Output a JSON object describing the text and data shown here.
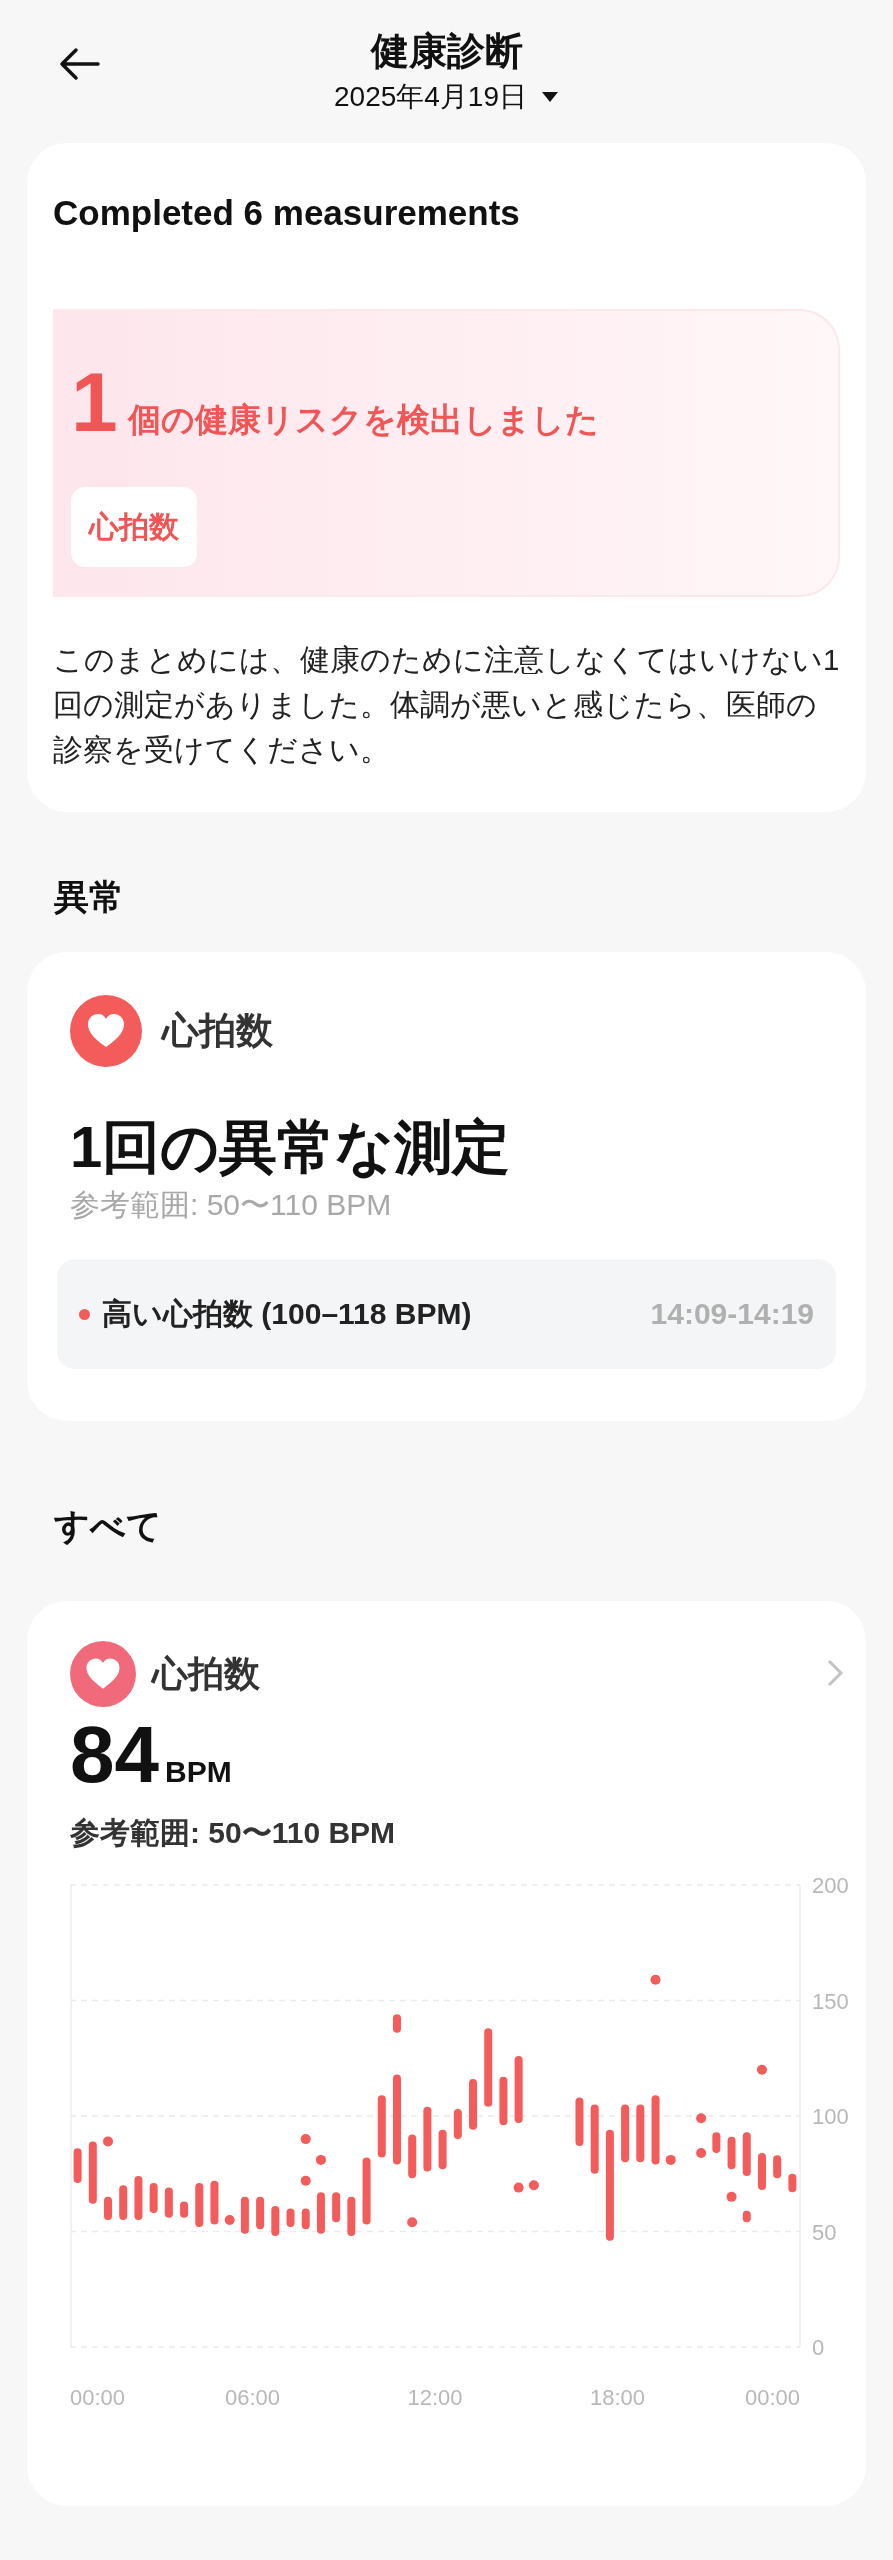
{
  "header": {
    "title": "健康診断",
    "date": "2025年4月19日"
  },
  "summary": {
    "title": "Completed 6 measurements",
    "risk_count": "1",
    "risk_text": "個の健康リスクを検出しました",
    "risk_chips": [
      "心拍数"
    ],
    "note": "このまとめには、健康のために注意しなくてはいけない1回の測定がありました。体調が悪いと感じたら、医師の診察を受けてください。"
  },
  "abnormal": {
    "heading": "異常",
    "metric": "心拍数",
    "count_text": "1回の異常な測定",
    "reference": "参考範囲: 50〜110 BPM",
    "events": [
      {
        "label": "高い心拍数 (100–118 BPM)",
        "time": "14:09-14:19",
        "color": "#f45b5b"
      }
    ]
  },
  "all": {
    "heading": "すべて",
    "metric": "心拍数",
    "value": "84",
    "unit": "BPM",
    "reference": "参考範囲: 50〜110 BPM",
    "chart_data": {
      "type": "candlestick",
      "grid": true,
      "x": [
        0.25,
        0.75,
        1.25,
        1.75,
        2.25,
        2.75,
        3.25,
        3.75,
        4.25,
        4.75,
        5.25,
        5.75,
        6.25,
        6.75,
        7.25,
        7.75,
        8.25,
        8.75,
        9.25,
        9.75,
        10.25,
        10.75,
        11.25,
        11.75,
        12.25,
        12.75,
        13.25,
        13.75,
        14.25,
        14.75,
        15.25,
        15.75,
        16.25,
        16.75,
        17.25,
        17.75,
        18.25,
        18.75,
        19.25,
        19.75,
        20.25,
        20.75,
        21.25,
        21.75,
        22.25,
        22.75,
        23.25,
        23.75
      ],
      "series": [
        {
          "color": "#f45b5b",
          "ohlc": [
            [
              71,
              86,
              71,
              86
            ],
            [
              62,
              89,
              62,
              89
            ],
            [
              55,
              65,
              55,
              65
            ],
            [
              55,
              70,
              55,
              70
            ],
            [
              55,
              74,
              55,
              74
            ],
            [
              58,
              71,
              58,
              71
            ],
            [
              56,
              69,
              56,
              69
            ],
            [
              56,
              63,
              56,
              63
            ],
            [
              52,
              71,
              52,
              71
            ],
            [
              53,
              72,
              53,
              72
            ],
            null,
            [
              49,
              65,
              49,
              65
            ],
            [
              51,
              65,
              51,
              65
            ],
            [
              48,
              61,
              48,
              61
            ],
            [
              52,
              60,
              52,
              60
            ],
            [
              51,
              60,
              51,
              60
            ],
            [
              49,
              67,
              49,
              67
            ],
            [
              54,
              67,
              54,
              67
            ],
            [
              48,
              65,
              48,
              65
            ],
            [
              53,
              82,
              53,
              82
            ],
            [
              82,
              109,
              82,
              109
            ],
            [
              79,
              118,
              79,
              118
            ],
            [
              73,
              92,
              73,
              92
            ],
            [
              76,
              104,
              76,
              104
            ],
            [
              77,
              94,
              77,
              94
            ],
            [
              90,
              103,
              90,
              103
            ],
            [
              94,
              116,
              94,
              116
            ],
            [
              104,
              138,
              104,
              138
            ],
            [
              96,
              117,
              96,
              117
            ],
            [
              97,
              126,
              97,
              126
            ],
            null,
            null,
            null,
            [
              87,
              108,
              87,
              108
            ],
            [
              75,
              105,
              75,
              105
            ],
            [
              46,
              94,
              46,
              94
            ],
            [
              80,
              105,
              80,
              105
            ],
            [
              80,
              105,
              80,
              105
            ],
            [
              79,
              109,
              79,
              109
            ],
            null,
            null,
            null,
            [
              84,
              93,
              84,
              93
            ],
            [
              77,
              91,
              77,
              91
            ],
            [
              74,
              93,
              74,
              93
            ],
            [
              68,
              84,
              68,
              84
            ],
            [
              73,
              83,
              73,
              83
            ],
            [
              67,
              75,
              67,
              75
            ]
          ]
        },
        {
          "color": "#f45b5b",
          "ohlc": [
            null,
            null,
            null,
            null,
            null,
            null,
            null,
            null,
            null,
            null,
            null,
            null,
            null,
            null,
            null,
            null,
            null,
            null,
            null,
            null,
            null,
            [
              136,
              144,
              136,
              144
            ],
            null,
            null,
            null,
            null,
            null,
            null,
            null,
            null,
            null,
            null,
            null,
            null,
            null,
            null,
            null,
            null,
            null,
            null,
            null,
            null,
            null,
            null,
            [
              54,
              59,
              54,
              59
            ],
            null,
            null,
            null
          ]
        },
        {
          "type": "scatter",
          "color": "#f45b5b",
          "values": [
            null,
            null,
            89,
            null,
            null,
            null,
            null,
            null,
            null,
            null,
            55,
            null,
            null,
            null,
            null,
            90,
            81,
            null,
            null,
            null,
            null,
            null,
            54,
            null,
            null,
            null,
            null,
            null,
            null,
            69,
            70,
            null,
            null,
            null,
            null,
            null,
            null,
            null,
            159,
            81,
            null,
            99,
            null,
            65,
            null,
            120,
            null,
            null
          ]
        },
        {
          "type": "scatter",
          "color": "#f45b5b",
          "values": [
            null,
            null,
            null,
            null,
            null,
            null,
            null,
            null,
            null,
            null,
            null,
            null,
            null,
            null,
            null,
            72,
            null,
            null,
            null,
            null,
            null,
            null,
            null,
            null,
            null,
            null,
            null,
            null,
            null,
            null,
            null,
            null,
            null,
            null,
            null,
            null,
            null,
            null,
            null,
            null,
            null,
            84,
            null,
            null,
            null,
            null,
            null,
            null
          ]
        }
      ],
      "xlim": [
        0,
        24
      ],
      "ylim": [
        0,
        200
      ],
      "xticks": [
        {
          "value": 0,
          "label": "00:00"
        },
        {
          "value": 6,
          "label": "06:00"
        },
        {
          "value": 12,
          "label": "12:00"
        },
        {
          "value": 18,
          "label": "18:00"
        },
        {
          "value": 24,
          "label": "00:00"
        }
      ],
      "yticks": [
        0,
        50,
        100,
        150,
        200
      ]
    }
  }
}
